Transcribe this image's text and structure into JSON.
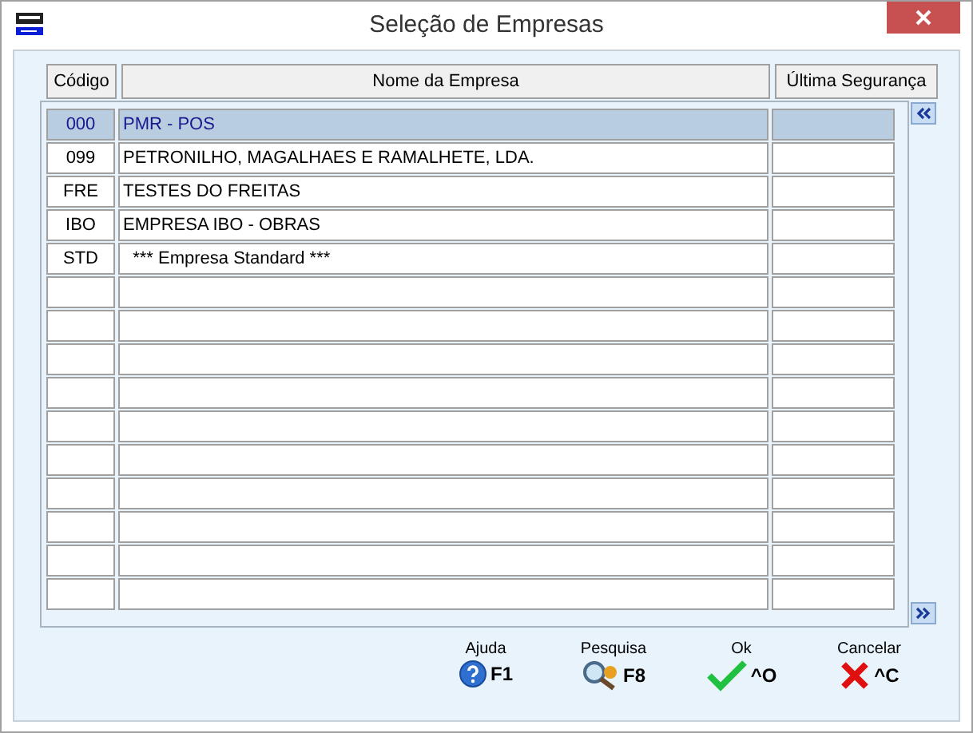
{
  "window": {
    "title": "Seleção de Empresas"
  },
  "table": {
    "columns": [
      "Código",
      "Nome da Empresa",
      "Última Segurança"
    ],
    "rows": [
      {
        "code": "000",
        "name": "PMR - POS",
        "selected": true
      },
      {
        "code": "099",
        "name": "PETRONILHO, MAGALHAES E RAMALHETE, LDA.",
        "selected": false
      },
      {
        "code": "FRE",
        "name": "TESTES DO FREITAS",
        "selected": false
      },
      {
        "code": "IBO",
        "name": "EMPRESA IBO - OBRAS",
        "selected": false
      },
      {
        "code": "STD",
        "name": "  *** Empresa Standard ***",
        "selected": false
      }
    ]
  },
  "actions": [
    {
      "kind": "help",
      "label": "Ajuda",
      "key": "F1"
    },
    {
      "kind": "search",
      "label": "Pesquisa",
      "key": "F8"
    },
    {
      "kind": "ok",
      "label": "Ok",
      "key": "^O"
    },
    {
      "kind": "cancel",
      "label": "Cancelar",
      "key": "^C"
    }
  ]
}
